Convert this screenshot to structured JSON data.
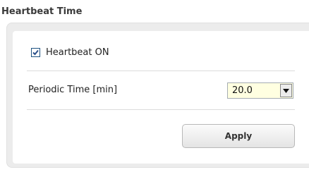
{
  "section": {
    "title": "Heartbeat Time"
  },
  "heartbeat": {
    "checkbox_label": "Heartbeat ON",
    "checked": true
  },
  "periodic": {
    "label": "Periodic Time [min]",
    "selected_value": "20.0"
  },
  "actions": {
    "apply_label": "Apply"
  },
  "colors": {
    "select_background": "#ffffe1",
    "panel_background": "#ececec",
    "checkmark": "#2a4f8a"
  }
}
